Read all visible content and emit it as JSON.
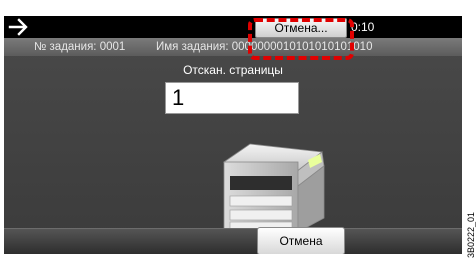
{
  "topbar": {
    "back_icon": "right-arrow-icon",
    "cancel_label": "Отмена...",
    "timer": "0:10"
  },
  "infobar": {
    "job_number": "№ задания: 0001",
    "job_name": "Имя задания: 0000000010101010101010"
  },
  "main": {
    "pages_label": "Отскан. страницы",
    "pages_value": "1",
    "device_icon": "copier-icon"
  },
  "bottom": {
    "cancel_label": "Отмена"
  },
  "side_code": "3B0222_01",
  "colors": {
    "highlight": "#e00000",
    "screen_bg": "#404040",
    "topbar_bg": "#000000"
  }
}
